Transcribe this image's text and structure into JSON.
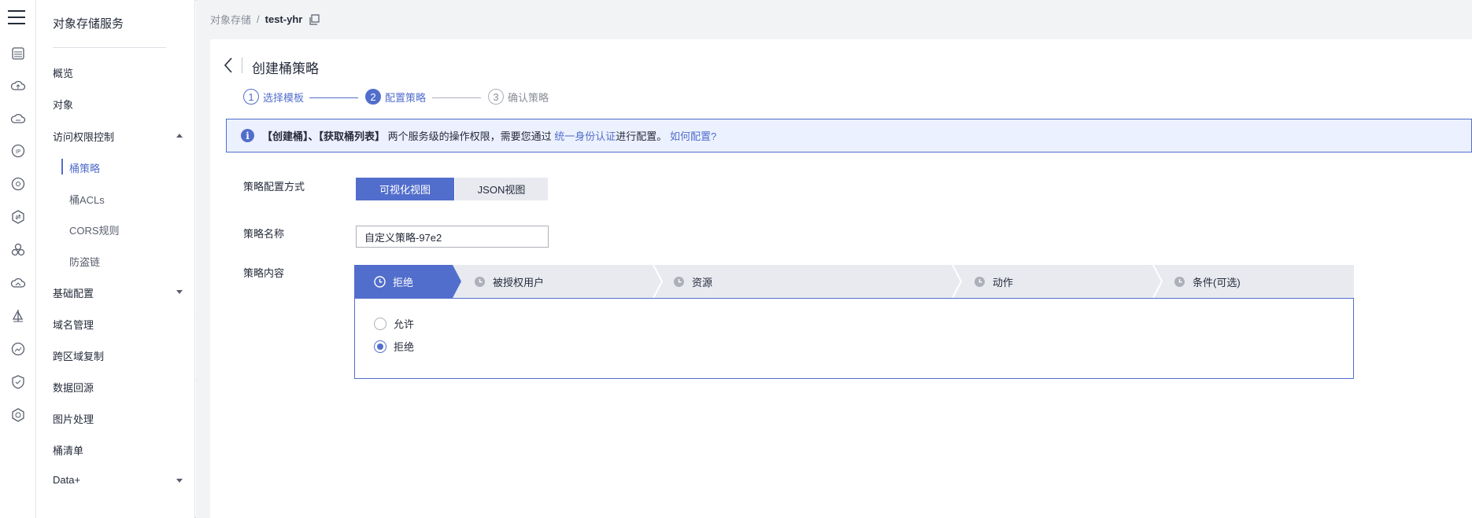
{
  "breadcrumb": {
    "root": "对象存储",
    "separator": "/",
    "current": "test-yhr"
  },
  "nav": {
    "title": "对象存储服务",
    "items": [
      {
        "label": "概览"
      },
      {
        "label": "对象"
      },
      {
        "label": "访问权限控制"
      },
      {
        "label": "桶策略"
      },
      {
        "label": "桶ACLs"
      },
      {
        "label": "CORS规则"
      },
      {
        "label": "防盗链"
      },
      {
        "label": "基础配置"
      },
      {
        "label": "域名管理"
      },
      {
        "label": "跨区域复制"
      },
      {
        "label": "数据回源"
      },
      {
        "label": "图片处理"
      },
      {
        "label": "桶清单"
      },
      {
        "label": "Data+"
      }
    ]
  },
  "page": {
    "title": "创建桶策略"
  },
  "steps": [
    {
      "num": "1",
      "label": "选择模板"
    },
    {
      "num": "2",
      "label": "配置策略"
    },
    {
      "num": "3",
      "label": "确认策略"
    }
  ],
  "banner": {
    "bold_text": "【创建桶】、【获取桶列表】",
    "text_1": "两个服务级的操作权限，需要您通过",
    "link_1": "统一身份认证",
    "text_2": "进行配置。",
    "link_2": "如何配置?"
  },
  "form": {
    "mode_label": "策略配置方式",
    "mode_visual": "可视化视图",
    "mode_json": "JSON视图",
    "name_label": "策略名称",
    "name_value": "自定义策略-97e2",
    "content_label": "策略内容"
  },
  "policy_steps": [
    {
      "label": "拒绝"
    },
    {
      "label": "被授权用户"
    },
    {
      "label": "资源"
    },
    {
      "label": "动作"
    },
    {
      "label": "条件(可选)"
    }
  ],
  "effect_options": [
    {
      "label": "允许",
      "checked": false
    },
    {
      "label": "拒绝",
      "checked": true
    }
  ],
  "colors": {
    "accent": "#526ecc",
    "banner_bg": "#ecf1ff",
    "tab_inactive": "#e8eaf0"
  }
}
